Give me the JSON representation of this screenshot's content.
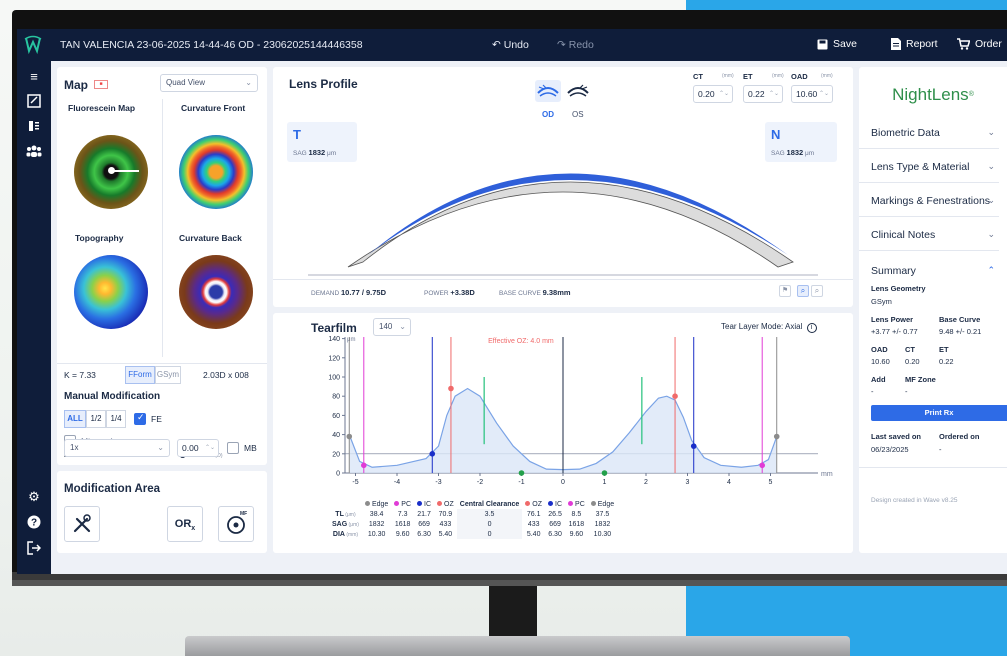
{
  "header": {
    "title": "TAN VALENCIA 23-06-2025 14-44-46  OD - 23062025144446358",
    "undo_label": "Undo",
    "redo_label": "Redo",
    "save_label": "Save",
    "report_label": "Report",
    "order_label": "Order"
  },
  "map": {
    "title": "Map",
    "view_select": "Quad View",
    "fluorescein_label": "Fluorescein Map",
    "curv_front_label": "Curvature Front",
    "topography_label": "Topography",
    "curv_back_label": "Curvature Back",
    "k_value": "K = 7.33",
    "fform_label": "FForm",
    "gsym_label": "GSym",
    "astig_value": "2.03D x 008"
  },
  "manual_mod": {
    "title": "Manual Modification",
    "seg_all": "ALL",
    "seg_half": "1/2",
    "seg_quarter": "1/4",
    "fe_label": "FE",
    "mirrored_label": "Mirrored",
    "increments_label": "Modification Increments",
    "s_label": "S",
    "unit": "(D)",
    "increment_value": "1x",
    "s_value": "0.00",
    "mb_label": "MB"
  },
  "mod_area": {
    "title": "Modification Area",
    "orx_label": "OR",
    "orx_sub": "x",
    "mf_label": "MF"
  },
  "lens_profile": {
    "title": "Lens Profile",
    "od_label": "OD",
    "os_label": "OS",
    "ct_label": "CT",
    "et_label": "ET",
    "oad_label": "OAD",
    "mm": "(mm)",
    "ct_value": "0.20",
    "et_value": "0.22",
    "oad_value": "10.60",
    "t_label": "T",
    "n_label": "N",
    "sag_label": "SAG",
    "sag_t_value": "1832",
    "sag_n_value": "1832",
    "um": "μm",
    "demand_label": "DEMAND",
    "demand_value": "10.77 / 9.75D",
    "power_label": "POWER",
    "power_value": "+3.38D",
    "base_curve_label": "BASE CURVE",
    "base_curve_value": "9.38mm"
  },
  "tearfilm": {
    "title": "Tearfilm",
    "select": "140",
    "mode_label": "Tear Layer Mode: Axial",
    "effective_oz": "Effective OZ: 4.0 mm",
    "y_unit": "μm",
    "x_unit": "mm",
    "yticks": [
      "140",
      "120",
      "100",
      "80",
      "60",
      "40",
      "20",
      "0"
    ],
    "xticks": [
      "-5",
      "-4",
      "-3",
      "-2",
      "-1",
      "0",
      "1",
      "2",
      "3",
      "4",
      "5"
    ],
    "table": {
      "row_labels": [
        "TL",
        "SAG",
        "DIA"
      ],
      "row_units": [
        "(μm)",
        "(μm)",
        "(mm)"
      ],
      "cols": [
        "Edge",
        "PC",
        "IC",
        "OZ",
        "Central Clearance",
        "OZ",
        "IC",
        "PC",
        "Edge"
      ],
      "col_colors": [
        "#8c8c8c",
        "#e03bd6",
        "#1a2ec8",
        "#f06a6a",
        "",
        "#f06a6a",
        "#1a2ec8",
        "#e03bd6",
        "#8c8c8c"
      ],
      "tl": [
        "38.4",
        "7.3",
        "21.7",
        "70.9",
        "3.5",
        "76.1",
        "26.5",
        "8.5",
        "37.5"
      ],
      "sag": [
        "1832",
        "1618",
        "669",
        "433",
        "0",
        "433",
        "669",
        "1618",
        "1832"
      ],
      "dia": [
        "10.30",
        "9.60",
        "6.30",
        "5.40",
        "0",
        "5.40",
        "6.30",
        "9.60",
        "10.30"
      ]
    }
  },
  "right_panel": {
    "brand": "NightLens",
    "acc": [
      "Biometric Data",
      "Lens Type & Material",
      "Markings & Fenestrations",
      "Clinical Notes"
    ],
    "summary_title": "Summary",
    "geometry_label": "Lens Geometry",
    "geometry_value": "GSym",
    "lens_power_label": "Lens Power",
    "lens_power_value": "+3.77 +/- 0.77",
    "base_curve_label": "Base Curve",
    "base_curve_value": "9.48 +/- 0.21",
    "oad_label": "OAD",
    "oad_value": "10.60",
    "ct_label": "CT",
    "ct_value": "0.20",
    "et_label": "ET",
    "et_value": "0.22",
    "add_label": "Add",
    "add_value": "-",
    "mf_zone_label": "MF Zone",
    "mf_zone_value": "-",
    "print_rx": "Print Rx",
    "last_saved_label": "Last saved on",
    "last_saved_value": "06/23/2025",
    "ordered_label": "Ordered on",
    "ordered_value": "-",
    "footer": "Design created in Wave v8.25"
  },
  "colors": {
    "navy": "#0f1d3a",
    "accent": "#2e6be6",
    "lens_blue": "#2f5fd9",
    "brand_green": "#2f8f4b"
  }
}
